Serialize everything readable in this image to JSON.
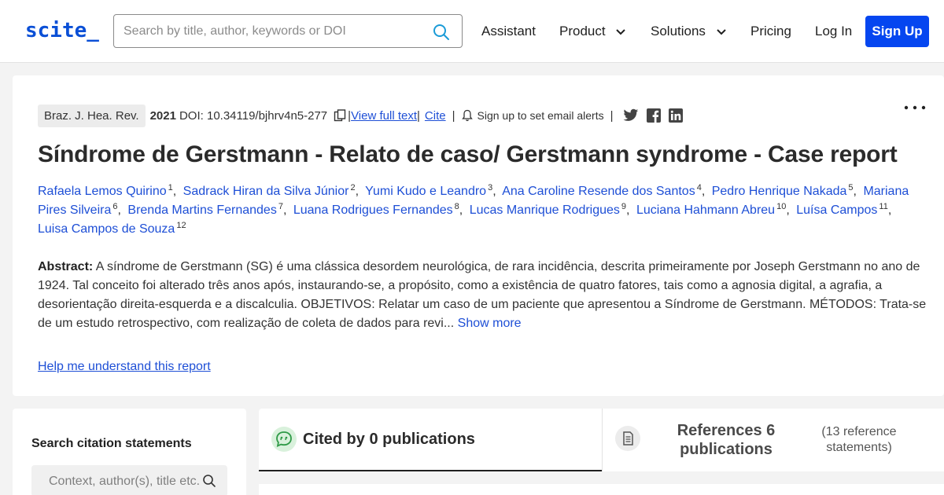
{
  "header": {
    "logo": "scite_",
    "search_placeholder": "Search by title, author, keywords or DOI",
    "nav": {
      "assistant": "Assistant",
      "product": "Product",
      "solutions": "Solutions",
      "pricing": "Pricing",
      "login": "Log In",
      "signup": "Sign Up"
    }
  },
  "article": {
    "journal": "Braz. J. Hea. Rev.",
    "year": "2021",
    "doi": "DOI: 10.34119/bjhrv4n5-277",
    "view_full_text": "View full text",
    "cite": "Cite",
    "alerts": "Sign up to set email alerts",
    "title": "Síndrome de Gerstmann - Relato de caso/ Gerstmann syndrome - Case report",
    "authors": [
      {
        "name": "Rafaela Lemos Quirino",
        "sup": "1"
      },
      {
        "name": "Sadrack Hiran da Silva Júnior",
        "sup": "2"
      },
      {
        "name": "Yumi Kudo e Leandro",
        "sup": "3"
      },
      {
        "name": "Ana Caroline Resende dos Santos",
        "sup": "4"
      },
      {
        "name": "Pedro Henrique Nakada",
        "sup": "5"
      },
      {
        "name": "Mariana Pires Silveira",
        "sup": "6"
      },
      {
        "name": "Brenda Martins Fernandes",
        "sup": "7"
      },
      {
        "name": "Luana Rodrigues Fernandes",
        "sup": "8"
      },
      {
        "name": "Lucas Manrique Rodrigues",
        "sup": "9"
      },
      {
        "name": "Luciana Hahmann Abreu",
        "sup": "10"
      },
      {
        "name": "Luísa Campos",
        "sup": "11"
      },
      {
        "name": "Luisa Campos de Souza",
        "sup": "12"
      }
    ],
    "abstract_label": "Abstract:",
    "abstract_text": "A síndrome de Gerstmann (SG) é uma clássica desordem neurológica, de rara incidência, descrita primeiramente por Joseph Gerstmann no ano de 1924. Tal conceito foi alterado três anos após, instaurando-se, a propósito, como a existência de quatro fatores, tais como a agnosia digital, a agrafia, a desorientação direita-esquerda e a discalculia. OBJETIVOS: Relatar um caso de um paciente que apresentou a Síndrome de Gerstmann. MÉTODOS: Trata-se de um estudo retrospectivo, com realização de coleta de dados para revi...",
    "show_more": "Show more",
    "help_link": "Help me understand this report"
  },
  "sidebar": {
    "title": "Search citation statements",
    "placeholder": "Context, author(s), title etc."
  },
  "tabs": {
    "cited_by": "Cited by 0 publications",
    "references": "References 6 publications",
    "reference_statements": "(13 reference statements)"
  },
  "icons": [
    "search-icon",
    "chevron-down-icon",
    "copy-icon",
    "bell-icon",
    "twitter-icon",
    "facebook-icon",
    "linkedin-icon",
    "more-icon",
    "quote-bubble-icon",
    "document-icon"
  ],
  "colors": {
    "accent": "#0546f0",
    "link": "#1e4fd6",
    "cited_icon_bg": "#d9f1dc"
  }
}
